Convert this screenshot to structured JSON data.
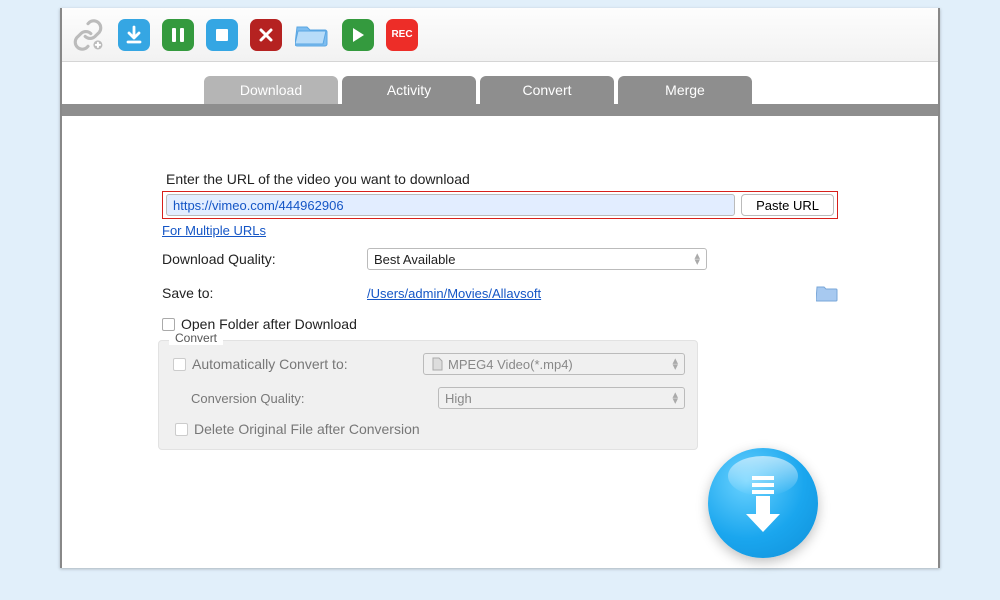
{
  "tabs": [
    {
      "label": "Download"
    },
    {
      "label": "Activity"
    },
    {
      "label": "Convert"
    },
    {
      "label": "Merge"
    }
  ],
  "url_section": {
    "prompt": "Enter the URL of the video you want to download",
    "value": "https://vimeo.com/444962906",
    "paste_label": "Paste URL",
    "multi_link": "For Multiple URLs"
  },
  "quality": {
    "label": "Download Quality:",
    "value": "Best Available"
  },
  "save_to": {
    "label": "Save to:",
    "path": "/Users/admin/Movies/Allavsoft"
  },
  "open_after": {
    "label": "Open Folder after Download"
  },
  "convert": {
    "legend": "Convert",
    "auto_label": "Automatically Convert to:",
    "format_value": "MPEG4 Video(*.mp4)",
    "quality_label": "Conversion Quality:",
    "quality_value": "High",
    "delete_label": "Delete Original File after Conversion"
  },
  "icons": {
    "rec": "REC"
  }
}
